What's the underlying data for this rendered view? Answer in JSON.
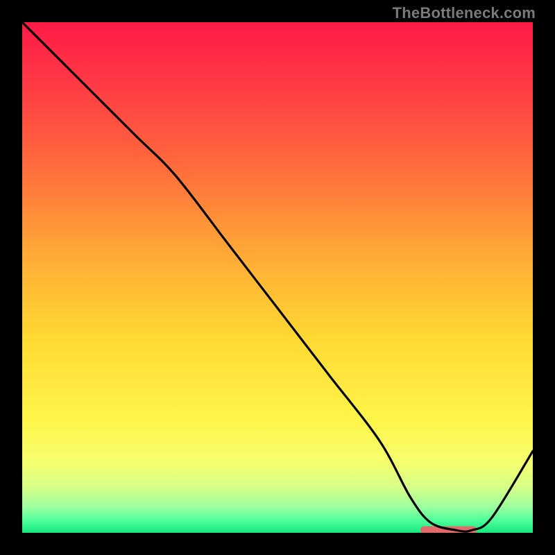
{
  "watermark": "TheBottleneck.com",
  "chart_data": {
    "type": "line",
    "title": "",
    "xlabel": "",
    "ylabel": "",
    "xlim": [
      0,
      100
    ],
    "ylim": [
      0,
      100
    ],
    "series": [
      {
        "name": "curve",
        "x": [
          0,
          10,
          22,
          30,
          40,
          50,
          60,
          70,
          76,
          80,
          85,
          88,
          92,
          100
        ],
        "y": [
          100,
          90,
          78,
          70,
          57,
          44,
          31,
          18,
          7,
          2,
          0.5,
          0.5,
          3,
          16
        ]
      }
    ],
    "marker": {
      "name": "optimal-range",
      "x_start": 78,
      "x_end": 89,
      "y": 0.6,
      "color": "#e36a6a"
    },
    "gradient_stops": [
      {
        "offset": 0.0,
        "color": "#ff1a46"
      },
      {
        "offset": 0.12,
        "color": "#ff3a45"
      },
      {
        "offset": 0.28,
        "color": "#ff6a3c"
      },
      {
        "offset": 0.45,
        "color": "#ffa836"
      },
      {
        "offset": 0.62,
        "color": "#ffd933"
      },
      {
        "offset": 0.78,
        "color": "#fff54a"
      },
      {
        "offset": 0.86,
        "color": "#f6ff6e"
      },
      {
        "offset": 0.91,
        "color": "#d8ff88"
      },
      {
        "offset": 0.95,
        "color": "#9cffa0"
      },
      {
        "offset": 0.975,
        "color": "#4fff9a"
      },
      {
        "offset": 1.0,
        "color": "#16e77f"
      }
    ]
  }
}
